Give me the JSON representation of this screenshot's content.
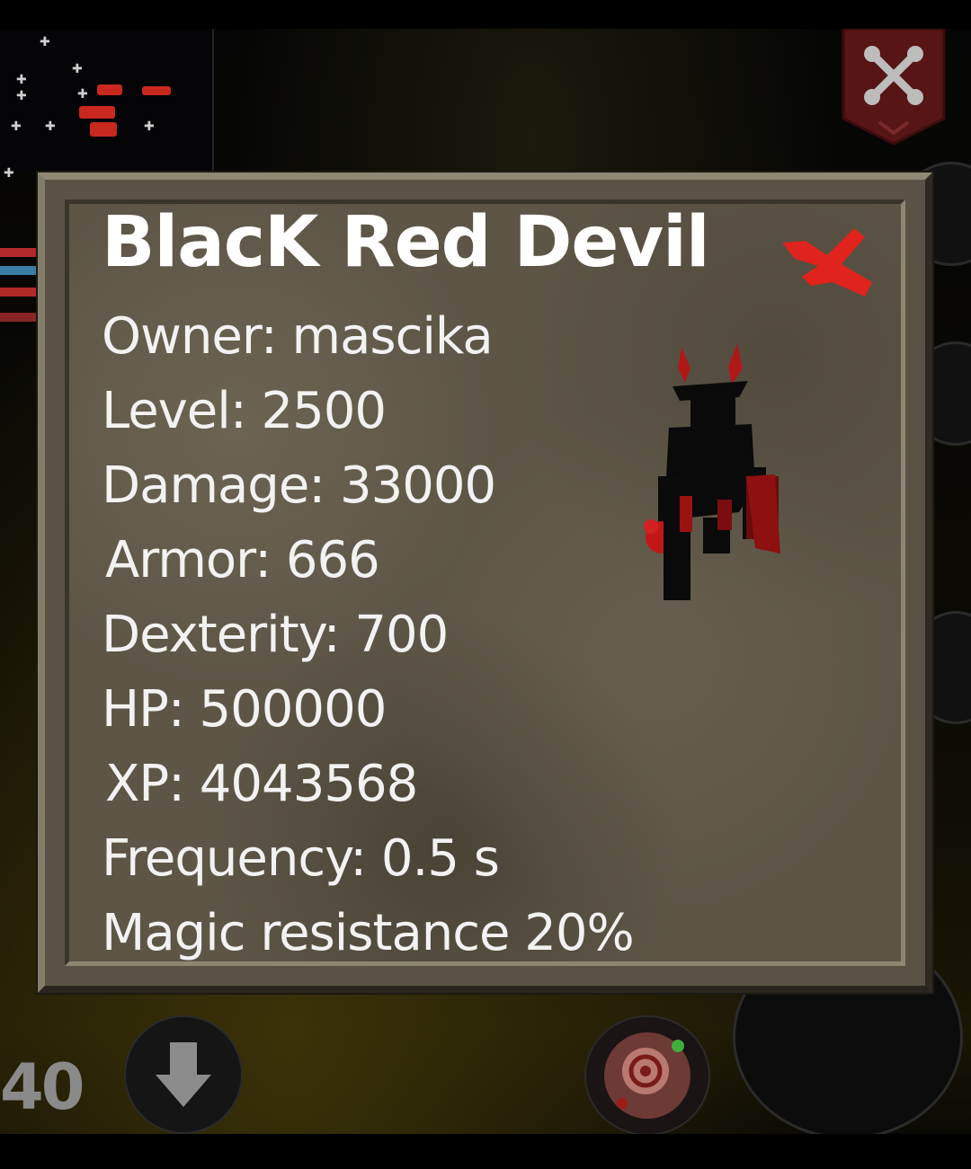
{
  "monster": {
    "name": "BlacK Red Devil",
    "owner_line": "Owner: mascika",
    "level_line": "Level: 2500",
    "damage_line": "Damage: 33000",
    "armor_line": "Armor: 666",
    "dexterity_line": "Dexterity: 700",
    "hp_line": "HP: 500000",
    "xp_line": "XP: 4043568",
    "frequency_line": "Frequency: 0.5 s",
    "magic_resistance_line": "Magic resistance 20%"
  },
  "hud": {
    "counter": "40"
  },
  "icons": {
    "close": "close-x-icon",
    "monster_sprite": "red-devil-sprite",
    "guild_banner": "crossed-swords-banner-icon",
    "down_arrow": "arrow-down-icon",
    "skill": "skill-orb-icon"
  },
  "colors": {
    "dialog_bg": "#5d5647",
    "title_text": "#ffffff",
    "stat_text": "#f2f2f2",
    "close_icon": "#e0231c",
    "banner": "#5a1414"
  }
}
